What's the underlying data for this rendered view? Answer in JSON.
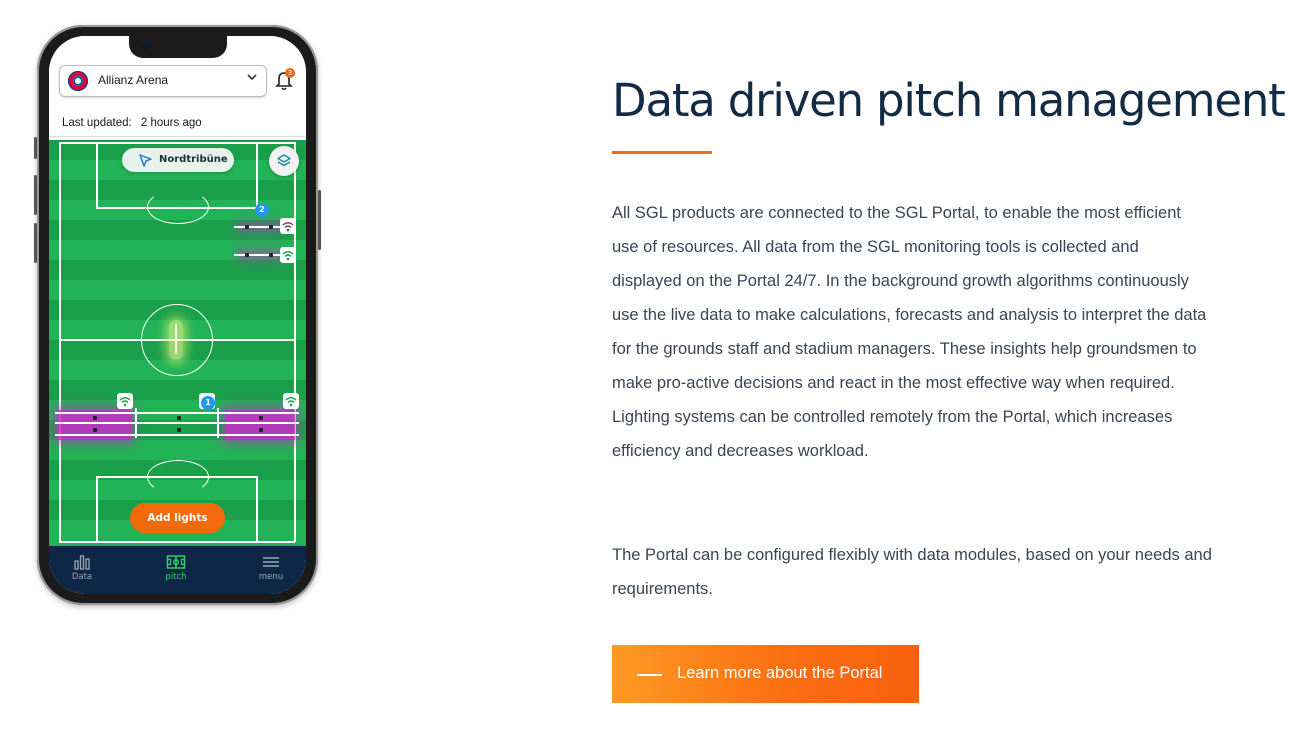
{
  "phone": {
    "venue": "Allianz Arena",
    "notification_count": "3",
    "last_updated_label": "Last updated:",
    "last_updated_value": "2 hours ago",
    "stand_label": "Nordtribüne",
    "lamp_group_badges": [
      "2",
      "1"
    ],
    "add_lights_label": "Add lights",
    "nav": [
      {
        "label": "Data",
        "icon": "bar-chart-icon",
        "active": false
      },
      {
        "label": "pitch",
        "icon": "pitch-icon",
        "active": true
      },
      {
        "label": "menu",
        "icon": "hamburger-menu-icon",
        "active": false
      }
    ],
    "colors": {
      "pitch_green": "#21b356",
      "nav_bg": "#0f2747",
      "accent_orange": "#f26a0c",
      "lamp_glow": "#cd28cd"
    }
  },
  "content": {
    "title": "Data driven pitch management",
    "paragraph1": "All SGL products are connected to the SGL Portal, to enable the most efficient use of resources. All data from the SGL monitoring tools is collected and displayed on the Portal 24/7. In the background growth algorithms continuously use the live data to make calculations, forecasts and analysis to interpret the data for the grounds staff and stadium managers. These insights help groundsmen to make pro-active decisions and react in the most effective way when required. Lighting systems can be controlled remotely from the Portal, which increases efficiency and decreases workload.",
    "paragraph2": "The Portal can be configured flexibly with data modules, based on your needs and requirements.",
    "cta_label": "Learn more about the Portal"
  },
  "colors": {
    "title": "#132b45",
    "body_text": "#3a4553",
    "accent": "#f26a10",
    "cta_gradient_start": "#ff9a23",
    "cta_gradient_end": "#f8610c"
  }
}
